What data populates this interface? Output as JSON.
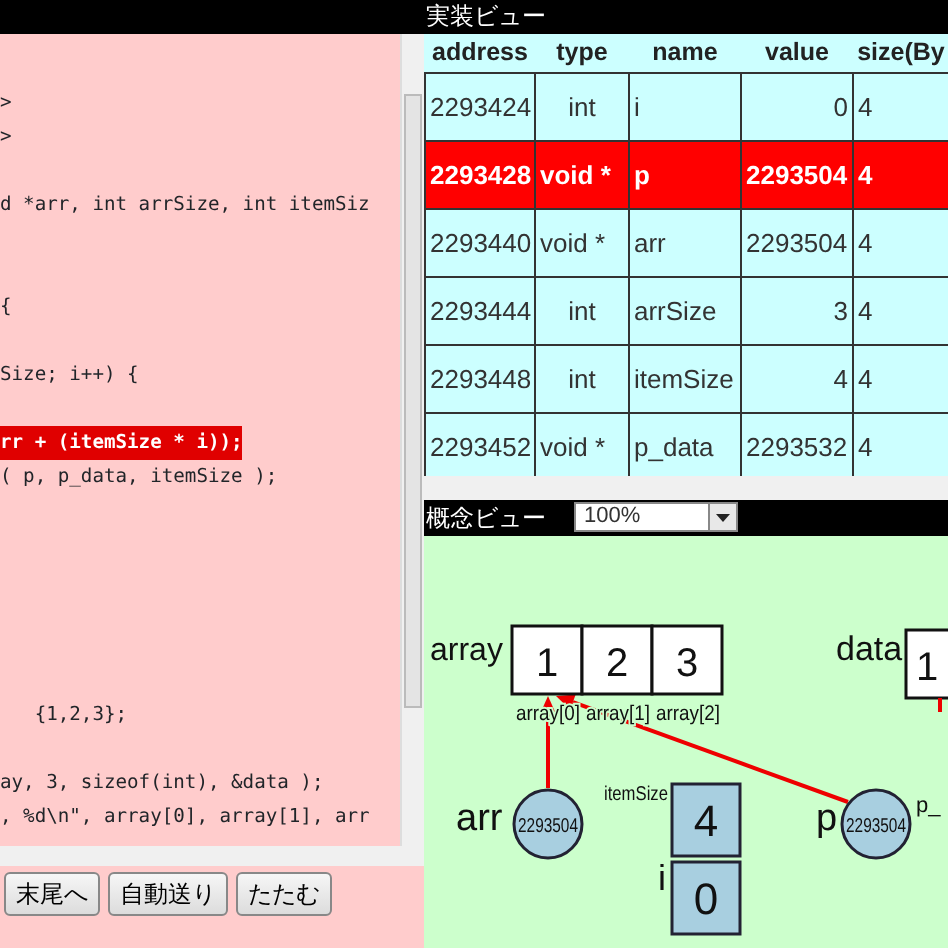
{
  "code_view": {
    "lines": [
      {
        "kind": "code",
        "text": ">",
        "highlighted": false
      },
      {
        "kind": "code",
        "text": ">",
        "highlighted": false
      },
      {
        "kind": "blank"
      },
      {
        "kind": "code",
        "text": "d *arr, int arrSize, int itemSiz",
        "highlighted": false
      },
      {
        "kind": "blank"
      },
      {
        "kind": "blank"
      },
      {
        "kind": "code",
        "text": "{",
        "highlighted": false
      },
      {
        "kind": "blank"
      },
      {
        "kind": "code",
        "text": "Size; i++) {",
        "highlighted": false
      },
      {
        "kind": "blank"
      },
      {
        "kind": "code",
        "text": "rr + (itemSize * i));",
        "highlighted": true
      },
      {
        "kind": "code",
        "text": "( p, p_data, itemSize );",
        "highlighted": false
      },
      {
        "kind": "blank"
      },
      {
        "kind": "blank"
      },
      {
        "kind": "blank"
      },
      {
        "kind": "blank"
      },
      {
        "kind": "blank"
      },
      {
        "kind": "blank"
      },
      {
        "kind": "code",
        "text": "   {1,2,3};",
        "highlighted": false
      },
      {
        "kind": "blank"
      },
      {
        "kind": "code",
        "text": "ay, 3, sizeof(int), &data );",
        "highlighted": false
      },
      {
        "kind": "code",
        "text": ", %d\\n\", array[0], array[1], arr",
        "highlighted": false
      }
    ]
  },
  "buttons": [
    "末尾へ",
    "自動送り",
    "たたむ"
  ],
  "implementation_view": {
    "title": "実装ビュー",
    "columns": [
      "address",
      "type",
      "name",
      "value",
      "size(By"
    ],
    "rows": [
      {
        "cells": [
          "2293424",
          "int",
          "i",
          "0",
          "4"
        ],
        "selected": false
      },
      {
        "cells": [
          "2293428",
          "void *",
          "p",
          "2293504",
          "4"
        ],
        "selected": true
      },
      {
        "cells": [
          "2293440",
          "void *",
          "arr",
          "2293504",
          "4"
        ],
        "selected": false
      },
      {
        "cells": [
          "2293444",
          "int",
          "arrSize",
          "3",
          "4"
        ],
        "selected": false
      },
      {
        "cells": [
          "2293448",
          "int",
          "itemSize",
          "4",
          "4"
        ],
        "selected": false
      },
      {
        "cells": [
          "2293452",
          "void *",
          "p_data",
          "2293532",
          "4"
        ],
        "selected": false
      }
    ]
  },
  "concept_view": {
    "title": "概念ビュー",
    "zoom": "100%",
    "array": {
      "label": "array",
      "items": [
        {
          "value": "1",
          "index": "array[0]"
        },
        {
          "value": "2",
          "index": "array[1]"
        },
        {
          "value": "3",
          "index": "array[2]"
        }
      ]
    },
    "data": {
      "label": "data",
      "value": "1"
    },
    "variables": [
      {
        "kind": "pointer",
        "name": "arr",
        "address": "2293504"
      },
      {
        "kind": "box",
        "name": "itemSize",
        "value": "4"
      },
      {
        "kind": "box",
        "name": "i",
        "value": "0"
      },
      {
        "kind": "pointer",
        "name": "p",
        "address": "2293504"
      },
      {
        "kind": "label",
        "name": "p_"
      }
    ]
  }
}
